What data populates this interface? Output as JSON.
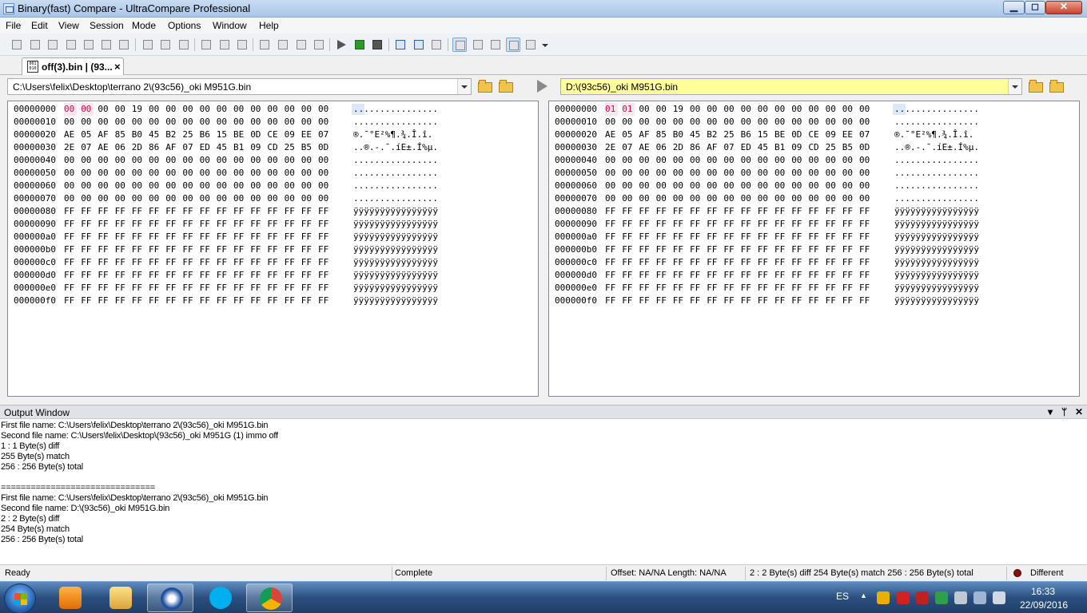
{
  "window": {
    "title": "Binary(fast) Compare - UltraCompare Professional",
    "min_glyph": "▁",
    "max_glyph": "◻",
    "close_glyph": "✕"
  },
  "menu": [
    "File",
    "Edit",
    "View",
    "Session",
    "Mode",
    "Options",
    "Window",
    "Help"
  ],
  "tab": {
    "label": "off(3).bin | (93...",
    "icon_text": "001 010",
    "close": "×"
  },
  "left_pane": {
    "path": "C:\\Users\\felix\\Desktop\\terrano 2\\(93c56)_oki M951G.bin",
    "rows": [
      {
        "offset": "00000000",
        "bytes": [
          "00",
          "00",
          "00",
          "00",
          "19",
          "00",
          "00",
          "00",
          "00",
          "00",
          "00",
          "00",
          "00",
          "00",
          "00",
          "00"
        ],
        "ascii": "................",
        "diff": [
          0,
          1
        ]
      },
      {
        "offset": "00000010",
        "bytes": [
          "00",
          "00",
          "00",
          "00",
          "00",
          "00",
          "00",
          "00",
          "00",
          "00",
          "00",
          "00",
          "00",
          "00",
          "00",
          "00"
        ],
        "ascii": "................",
        "diff": []
      },
      {
        "offset": "00000020",
        "bytes": [
          "AE",
          "05",
          "AF",
          "85",
          "B0",
          "45",
          "B2",
          "25",
          "B6",
          "15",
          "BE",
          "0D",
          "CE",
          "09",
          "EE",
          "07"
        ],
        "ascii": "®.¯°E²%¶.¾.Î.î.",
        "diff": []
      },
      {
        "offset": "00000030",
        "bytes": [
          "2E",
          "07",
          "AE",
          "06",
          "2D",
          "86",
          "AF",
          "07",
          "ED",
          "45",
          "B1",
          "09",
          "CD",
          "25",
          "B5",
          "0D"
        ],
        "ascii": "..®.-.¯.íE±.Í%µ.",
        "diff": []
      },
      {
        "offset": "00000040",
        "bytes": [
          "00",
          "00",
          "00",
          "00",
          "00",
          "00",
          "00",
          "00",
          "00",
          "00",
          "00",
          "00",
          "00",
          "00",
          "00",
          "00"
        ],
        "ascii": "................",
        "diff": []
      },
      {
        "offset": "00000050",
        "bytes": [
          "00",
          "00",
          "00",
          "00",
          "00",
          "00",
          "00",
          "00",
          "00",
          "00",
          "00",
          "00",
          "00",
          "00",
          "00",
          "00"
        ],
        "ascii": "................",
        "diff": []
      },
      {
        "offset": "00000060",
        "bytes": [
          "00",
          "00",
          "00",
          "00",
          "00",
          "00",
          "00",
          "00",
          "00",
          "00",
          "00",
          "00",
          "00",
          "00",
          "00",
          "00"
        ],
        "ascii": "................",
        "diff": []
      },
      {
        "offset": "00000070",
        "bytes": [
          "00",
          "00",
          "00",
          "00",
          "00",
          "00",
          "00",
          "00",
          "00",
          "00",
          "00",
          "00",
          "00",
          "00",
          "00",
          "00"
        ],
        "ascii": "................",
        "diff": []
      },
      {
        "offset": "00000080",
        "bytes": [
          "FF",
          "FF",
          "FF",
          "FF",
          "FF",
          "FF",
          "FF",
          "FF",
          "FF",
          "FF",
          "FF",
          "FF",
          "FF",
          "FF",
          "FF",
          "FF"
        ],
        "ascii": "ÿÿÿÿÿÿÿÿÿÿÿÿÿÿÿÿ",
        "diff": []
      },
      {
        "offset": "00000090",
        "bytes": [
          "FF",
          "FF",
          "FF",
          "FF",
          "FF",
          "FF",
          "FF",
          "FF",
          "FF",
          "FF",
          "FF",
          "FF",
          "FF",
          "FF",
          "FF",
          "FF"
        ],
        "ascii": "ÿÿÿÿÿÿÿÿÿÿÿÿÿÿÿÿ",
        "diff": []
      },
      {
        "offset": "000000a0",
        "bytes": [
          "FF",
          "FF",
          "FF",
          "FF",
          "FF",
          "FF",
          "FF",
          "FF",
          "FF",
          "FF",
          "FF",
          "FF",
          "FF",
          "FF",
          "FF",
          "FF"
        ],
        "ascii": "ÿÿÿÿÿÿÿÿÿÿÿÿÿÿÿÿ",
        "diff": []
      },
      {
        "offset": "000000b0",
        "bytes": [
          "FF",
          "FF",
          "FF",
          "FF",
          "FF",
          "FF",
          "FF",
          "FF",
          "FF",
          "FF",
          "FF",
          "FF",
          "FF",
          "FF",
          "FF",
          "FF"
        ],
        "ascii": "ÿÿÿÿÿÿÿÿÿÿÿÿÿÿÿÿ",
        "diff": []
      },
      {
        "offset": "000000c0",
        "bytes": [
          "FF",
          "FF",
          "FF",
          "FF",
          "FF",
          "FF",
          "FF",
          "FF",
          "FF",
          "FF",
          "FF",
          "FF",
          "FF",
          "FF",
          "FF",
          "FF"
        ],
        "ascii": "ÿÿÿÿÿÿÿÿÿÿÿÿÿÿÿÿ",
        "diff": []
      },
      {
        "offset": "000000d0",
        "bytes": [
          "FF",
          "FF",
          "FF",
          "FF",
          "FF",
          "FF",
          "FF",
          "FF",
          "FF",
          "FF",
          "FF",
          "FF",
          "FF",
          "FF",
          "FF",
          "FF"
        ],
        "ascii": "ÿÿÿÿÿÿÿÿÿÿÿÿÿÿÿÿ",
        "diff": []
      },
      {
        "offset": "000000e0",
        "bytes": [
          "FF",
          "FF",
          "FF",
          "FF",
          "FF",
          "FF",
          "FF",
          "FF",
          "FF",
          "FF",
          "FF",
          "FF",
          "FF",
          "FF",
          "FF",
          "FF"
        ],
        "ascii": "ÿÿÿÿÿÿÿÿÿÿÿÿÿÿÿÿ",
        "diff": []
      },
      {
        "offset": "000000f0",
        "bytes": [
          "FF",
          "FF",
          "FF",
          "FF",
          "FF",
          "FF",
          "FF",
          "FF",
          "FF",
          "FF",
          "FF",
          "FF",
          "FF",
          "FF",
          "FF",
          "FF"
        ],
        "ascii": "ÿÿÿÿÿÿÿÿÿÿÿÿÿÿÿÿ",
        "diff": []
      }
    ]
  },
  "right_pane": {
    "path": "D:\\(93c56)_oki M951G.bin",
    "rows": [
      {
        "offset": "00000000",
        "bytes": [
          "01",
          "01",
          "00",
          "00",
          "19",
          "00",
          "00",
          "00",
          "00",
          "00",
          "00",
          "00",
          "00",
          "00",
          "00",
          "00"
        ],
        "ascii": "................",
        "diff": [
          0,
          1
        ]
      },
      {
        "offset": "00000010",
        "bytes": [
          "00",
          "00",
          "00",
          "00",
          "00",
          "00",
          "00",
          "00",
          "00",
          "00",
          "00",
          "00",
          "00",
          "00",
          "00",
          "00"
        ],
        "ascii": "................",
        "diff": []
      },
      {
        "offset": "00000020",
        "bytes": [
          "AE",
          "05",
          "AF",
          "85",
          "B0",
          "45",
          "B2",
          "25",
          "B6",
          "15",
          "BE",
          "0D",
          "CE",
          "09",
          "EE",
          "07"
        ],
        "ascii": "®.¯°E²%¶.¾.Î.î.",
        "diff": []
      },
      {
        "offset": "00000030",
        "bytes": [
          "2E",
          "07",
          "AE",
          "06",
          "2D",
          "86",
          "AF",
          "07",
          "ED",
          "45",
          "B1",
          "09",
          "CD",
          "25",
          "B5",
          "0D"
        ],
        "ascii": "..®.-.¯.íE±.Í%µ.",
        "diff": []
      },
      {
        "offset": "00000040",
        "bytes": [
          "00",
          "00",
          "00",
          "00",
          "00",
          "00",
          "00",
          "00",
          "00",
          "00",
          "00",
          "00",
          "00",
          "00",
          "00",
          "00"
        ],
        "ascii": "................",
        "diff": []
      },
      {
        "offset": "00000050",
        "bytes": [
          "00",
          "00",
          "00",
          "00",
          "00",
          "00",
          "00",
          "00",
          "00",
          "00",
          "00",
          "00",
          "00",
          "00",
          "00",
          "00"
        ],
        "ascii": "................",
        "diff": []
      },
      {
        "offset": "00000060",
        "bytes": [
          "00",
          "00",
          "00",
          "00",
          "00",
          "00",
          "00",
          "00",
          "00",
          "00",
          "00",
          "00",
          "00",
          "00",
          "00",
          "00"
        ],
        "ascii": "................",
        "diff": []
      },
      {
        "offset": "00000070",
        "bytes": [
          "00",
          "00",
          "00",
          "00",
          "00",
          "00",
          "00",
          "00",
          "00",
          "00",
          "00",
          "00",
          "00",
          "00",
          "00",
          "00"
        ],
        "ascii": "................",
        "diff": []
      },
      {
        "offset": "00000080",
        "bytes": [
          "FF",
          "FF",
          "FF",
          "FF",
          "FF",
          "FF",
          "FF",
          "FF",
          "FF",
          "FF",
          "FF",
          "FF",
          "FF",
          "FF",
          "FF",
          "FF"
        ],
        "ascii": "ÿÿÿÿÿÿÿÿÿÿÿÿÿÿÿÿ",
        "diff": []
      },
      {
        "offset": "00000090",
        "bytes": [
          "FF",
          "FF",
          "FF",
          "FF",
          "FF",
          "FF",
          "FF",
          "FF",
          "FF",
          "FF",
          "FF",
          "FF",
          "FF",
          "FF",
          "FF",
          "FF"
        ],
        "ascii": "ÿÿÿÿÿÿÿÿÿÿÿÿÿÿÿÿ",
        "diff": []
      },
      {
        "offset": "000000a0",
        "bytes": [
          "FF",
          "FF",
          "FF",
          "FF",
          "FF",
          "FF",
          "FF",
          "FF",
          "FF",
          "FF",
          "FF",
          "FF",
          "FF",
          "FF",
          "FF",
          "FF"
        ],
        "ascii": "ÿÿÿÿÿÿÿÿÿÿÿÿÿÿÿÿ",
        "diff": []
      },
      {
        "offset": "000000b0",
        "bytes": [
          "FF",
          "FF",
          "FF",
          "FF",
          "FF",
          "FF",
          "FF",
          "FF",
          "FF",
          "FF",
          "FF",
          "FF",
          "FF",
          "FF",
          "FF",
          "FF"
        ],
        "ascii": "ÿÿÿÿÿÿÿÿÿÿÿÿÿÿÿÿ",
        "diff": []
      },
      {
        "offset": "000000c0",
        "bytes": [
          "FF",
          "FF",
          "FF",
          "FF",
          "FF",
          "FF",
          "FF",
          "FF",
          "FF",
          "FF",
          "FF",
          "FF",
          "FF",
          "FF",
          "FF",
          "FF"
        ],
        "ascii": "ÿÿÿÿÿÿÿÿÿÿÿÿÿÿÿÿ",
        "diff": []
      },
      {
        "offset": "000000d0",
        "bytes": [
          "FF",
          "FF",
          "FF",
          "FF",
          "FF",
          "FF",
          "FF",
          "FF",
          "FF",
          "FF",
          "FF",
          "FF",
          "FF",
          "FF",
          "FF",
          "FF"
        ],
        "ascii": "ÿÿÿÿÿÿÿÿÿÿÿÿÿÿÿÿ",
        "diff": []
      },
      {
        "offset": "000000e0",
        "bytes": [
          "FF",
          "FF",
          "FF",
          "FF",
          "FF",
          "FF",
          "FF",
          "FF",
          "FF",
          "FF",
          "FF",
          "FF",
          "FF",
          "FF",
          "FF",
          "FF"
        ],
        "ascii": "ÿÿÿÿÿÿÿÿÿÿÿÿÿÿÿÿ",
        "diff": []
      },
      {
        "offset": "000000f0",
        "bytes": [
          "FF",
          "FF",
          "FF",
          "FF",
          "FF",
          "FF",
          "FF",
          "FF",
          "FF",
          "FF",
          "FF",
          "FF",
          "FF",
          "FF",
          "FF",
          "FF"
        ],
        "ascii": "ÿÿÿÿÿÿÿÿÿÿÿÿÿÿÿÿ",
        "diff": []
      }
    ]
  },
  "output": {
    "title": "Output Window",
    "lines": [
      "First file name: C:\\Users\\felix\\Desktop\\terrano 2\\(93c56)_oki M951G.bin",
      "Second file name: C:\\Users\\felix\\Desktop\\(93c56)_oki M951G (1) immo off",
      "1 : 1 Byte(s) diff",
      "255 Byte(s) match",
      "256 : 256 Byte(s) total",
      "",
      "===============================",
      "First file name: C:\\Users\\felix\\Desktop\\terrano 2\\(93c56)_oki M951G.bin",
      "Second file name: D:\\(93c56)_oki M951G.bin",
      "2 : 2 Byte(s) diff",
      "254 Byte(s) match",
      "256 : 256 Byte(s) total"
    ]
  },
  "status": {
    "ready": "Ready",
    "complete": "Complete",
    "offset": "Offset: NA/NA  Length: NA/NA",
    "summary": "2 : 2 Byte(s) diff   254 Byte(s) match   256 : 256 Byte(s) total",
    "result": "Different"
  },
  "taskbar": {
    "lang": "ES",
    "time": "16:33",
    "date": "22/09/2016"
  },
  "colors": {
    "diff": "#e0004a",
    "path_highlight": "#ffff99"
  }
}
